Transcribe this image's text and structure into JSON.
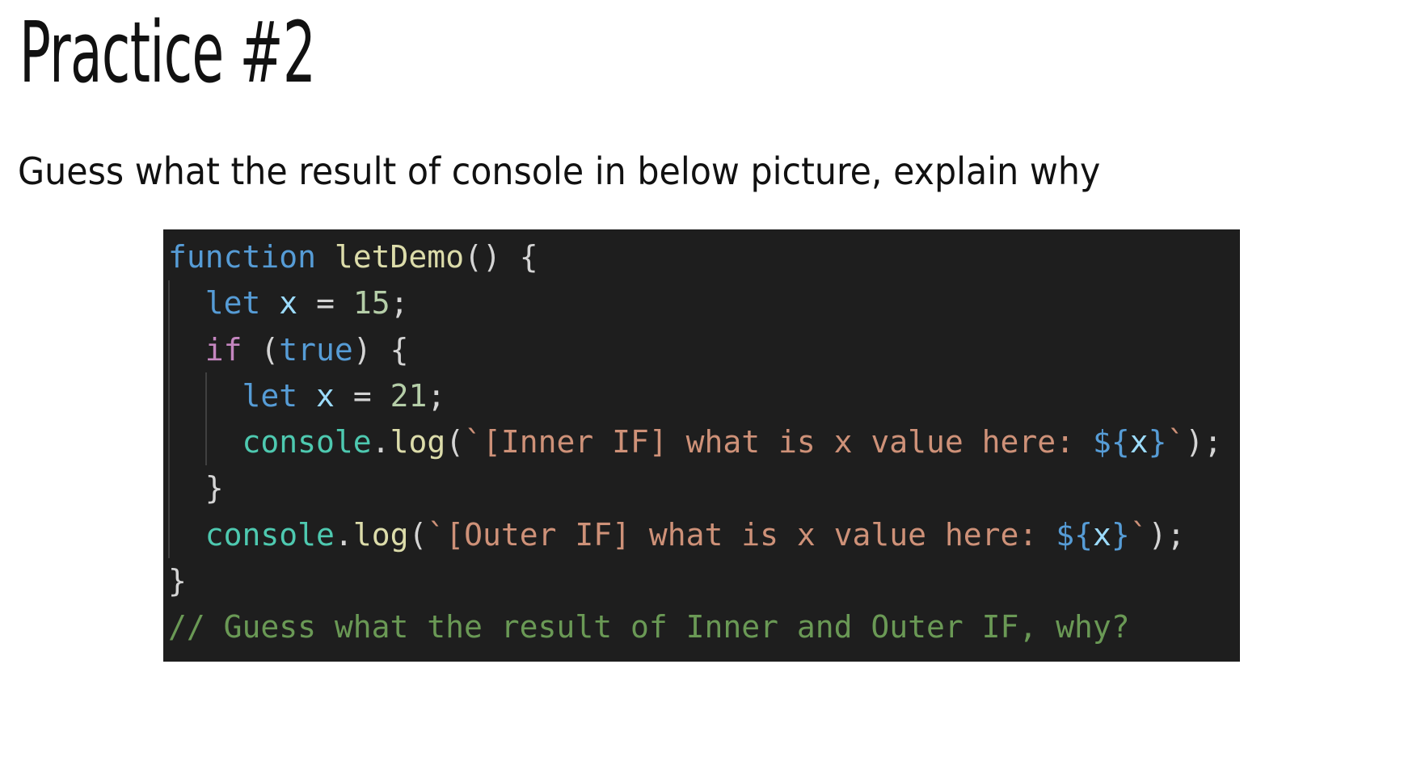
{
  "title": "Practice #2",
  "prompt": "Guess what the result of console in below picture, explain why",
  "code": {
    "line1": {
      "kw": "function",
      "sp": " ",
      "name": "letDemo",
      "rest": "() {"
    },
    "line2": {
      "indent": "  ",
      "kw": "let",
      "sp": " ",
      "var": "x",
      "op": " = ",
      "num": "15",
      "end": ";"
    },
    "line3": {
      "indent": "  ",
      "kw": "if",
      "open": " (",
      "val": "true",
      "close": ") {"
    },
    "line4": {
      "indent": "    ",
      "kw": "let",
      "sp": " ",
      "var": "x",
      "op": " = ",
      "num": "21",
      "end": ";"
    },
    "line5": {
      "indent": "    ",
      "obj": "console",
      "dot": ".",
      "method": "log",
      "open": "(",
      "str": "`[Inner IF] what is x value here: ",
      "interp_open": "${",
      "interp_var": "x",
      "interp_close": "}",
      "str_end": "`",
      "close": ");"
    },
    "line6": {
      "indent": "  ",
      "brace": "}"
    },
    "line7": {
      "indent": "  ",
      "obj": "console",
      "dot": ".",
      "method": "log",
      "open": "(",
      "str": "`[Outer IF] what is x value here: ",
      "interp_open": "${",
      "interp_var": "x",
      "interp_close": "}",
      "str_end": "`",
      "close": ");"
    },
    "line8": {
      "brace": "}"
    },
    "line9": {
      "comment": "// Guess what the result of Inner and Outer IF, why?"
    }
  },
  "colors": {
    "background": "#1e1e1e",
    "keyword": "#569cd6",
    "control": "#c586c0",
    "function": "#dcdcaa",
    "variable": "#9cdcfe",
    "number": "#b5cea8",
    "object": "#4ec9b0",
    "string": "#ce9178",
    "comment": "#6a9955"
  }
}
